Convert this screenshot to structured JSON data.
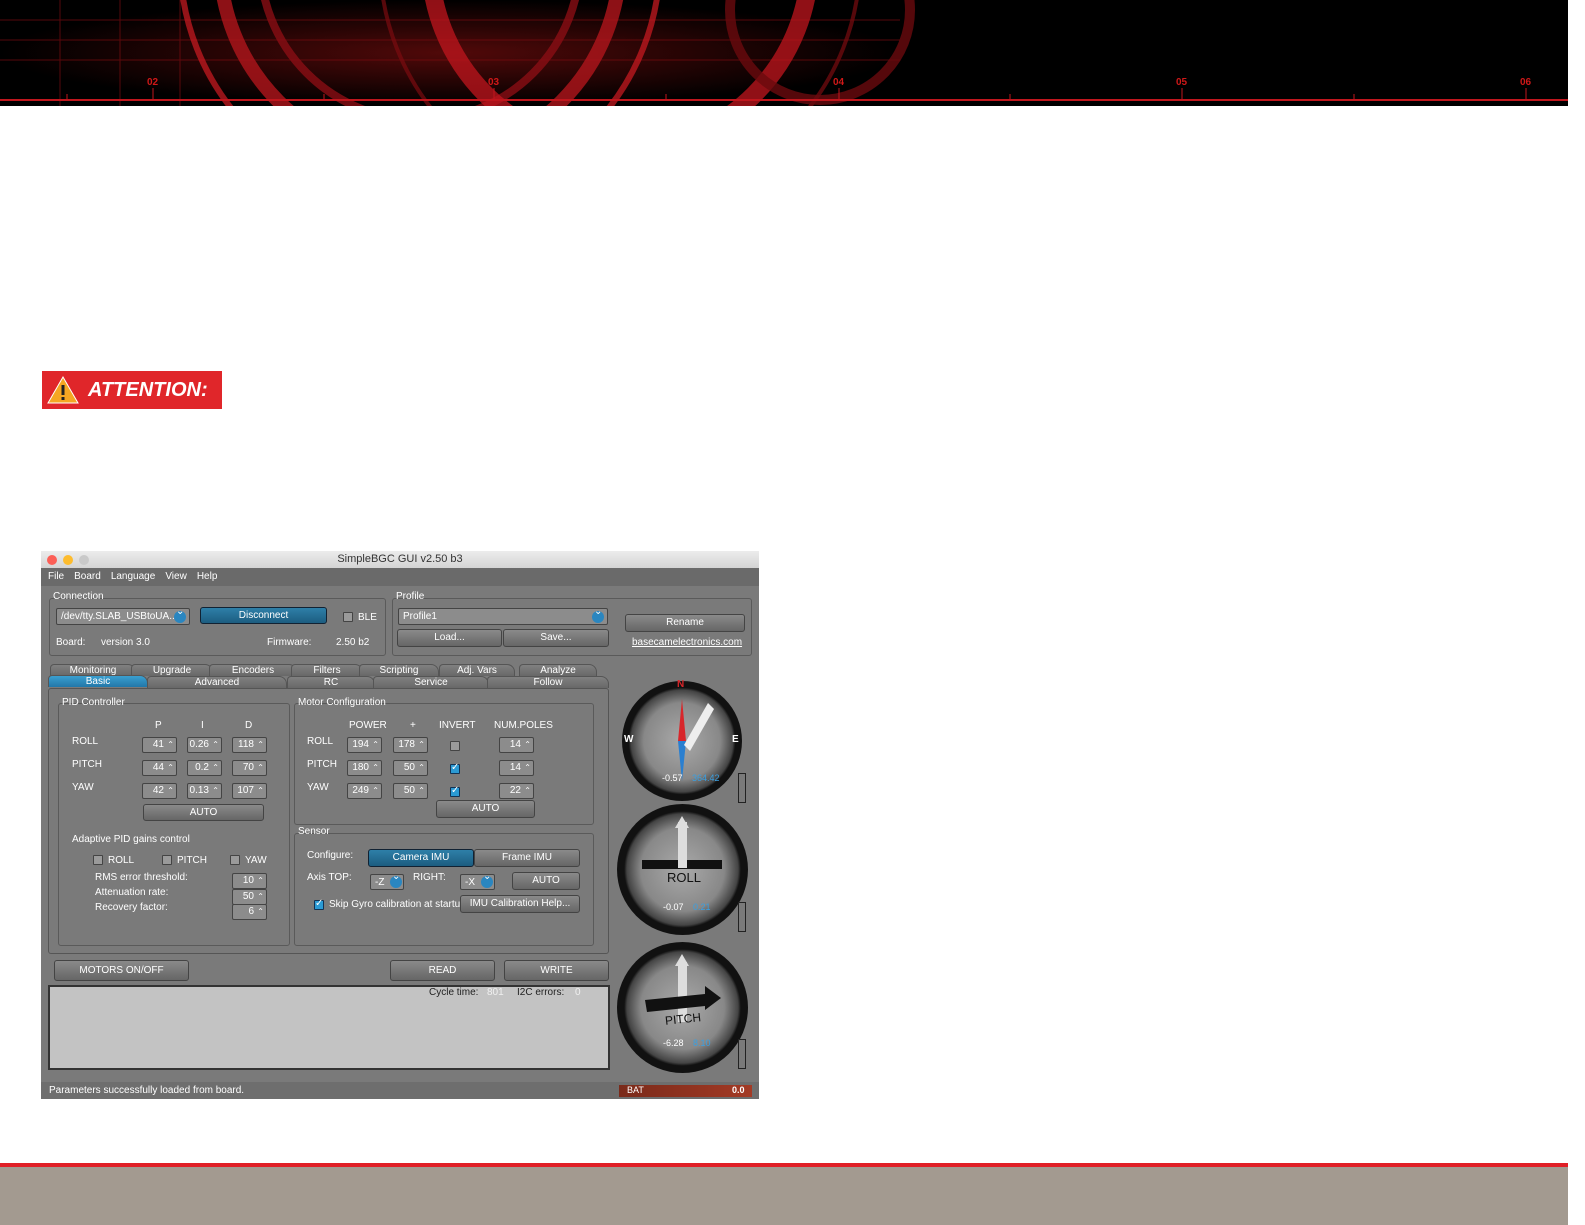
{
  "banner": {
    "tick_numbers": [
      "02",
      "03",
      "04",
      "05",
      "06"
    ]
  },
  "attention": {
    "label": "ATTENTION:"
  },
  "app": {
    "title": "SimpleBGC GUI v2.50 b3",
    "menu": [
      "File",
      "Board",
      "Language",
      "View",
      "Help"
    ],
    "connection": {
      "group_label": "Connection",
      "port": "/dev/tty.SLAB_USBtoUA...",
      "disconnect_label": "Disconnect",
      "ble_label": "BLE",
      "board_label": "Board:",
      "board_value": "version 3.0",
      "firmware_label": "Firmware:",
      "firmware_value": "2.50 b2"
    },
    "profile": {
      "group_label": "Profile",
      "selected": "Profile1",
      "load_label": "Load...",
      "save_label": "Save...",
      "rename_label": "Rename",
      "link": "basecamelectronics.com"
    },
    "tabs_top": [
      "Monitoring",
      "Upgrade",
      "Encoders",
      "Filters",
      "Scripting",
      "Adj. Vars",
      "Analyze"
    ],
    "tabs_bottom": [
      "Basic",
      "Advanced",
      "RC",
      "Service",
      "Follow"
    ],
    "pid": {
      "group_label": "PID Controller",
      "headers": [
        "P",
        "I",
        "D"
      ],
      "rows": [
        {
          "label": "ROLL",
          "p": "41",
          "i": "0.26",
          "d": "118"
        },
        {
          "label": "PITCH",
          "p": "44",
          "i": "0.2",
          "d": "70"
        },
        {
          "label": "YAW",
          "p": "42",
          "i": "0.13",
          "d": "107"
        }
      ],
      "auto_label": "AUTO",
      "adaptive_label": "Adaptive PID gains control",
      "adaptive_checks": [
        "ROLL",
        "PITCH",
        "YAW"
      ],
      "rms_label": "RMS error threshold:",
      "rms_value": "10",
      "atten_label": "Attenuation rate:",
      "atten_value": "50",
      "recovery_label": "Recovery factor:",
      "recovery_value": "6"
    },
    "motor": {
      "group_label": "Motor Configuration",
      "headers": [
        "POWER",
        "+",
        "INVERT",
        "NUM.POLES"
      ],
      "rows": [
        {
          "label": "ROLL",
          "power": "194",
          "plus": "178",
          "invert": false,
          "poles": "14"
        },
        {
          "label": "PITCH",
          "power": "180",
          "plus": "50",
          "invert": true,
          "poles": "14"
        },
        {
          "label": "YAW",
          "power": "249",
          "plus": "50",
          "invert": true,
          "poles": "22"
        }
      ],
      "auto_label": "AUTO"
    },
    "sensor": {
      "group_label": "Sensor",
      "configure_label": "Configure:",
      "camera_imu": "Camera IMU",
      "frame_imu": "Frame IMU",
      "axis_top_label": "Axis TOP:",
      "axis_top_value": "-Z",
      "right_label": "RIGHT:",
      "right_value": "-X",
      "auto_label": "AUTO",
      "skip_gyro_label": "Skip Gyro calibration at startu",
      "imu_help_label": "IMU Calibration Help..."
    },
    "bottom": {
      "motors_label": "MOTORS ON/OFF",
      "read_label": "READ",
      "write_label": "WRITE",
      "cycle_label": "Cycle time:",
      "cycle_value": "801",
      "i2c_label": "I2C errors:",
      "i2c_value": "0"
    },
    "status": {
      "message": "Parameters successfully loaded from board.",
      "bat_label": "BAT",
      "bat_value": "0.0"
    },
    "gauges": {
      "yaw": {
        "n": "N",
        "w": "W",
        "e": "E",
        "left": "-0.57",
        "right": "364.42"
      },
      "roll": {
        "label": "ROLL",
        "left": "-0.07",
        "right": "0.21"
      },
      "pitch": {
        "label": "PITCH",
        "left": "-6.28",
        "right": "8.10"
      }
    }
  }
}
